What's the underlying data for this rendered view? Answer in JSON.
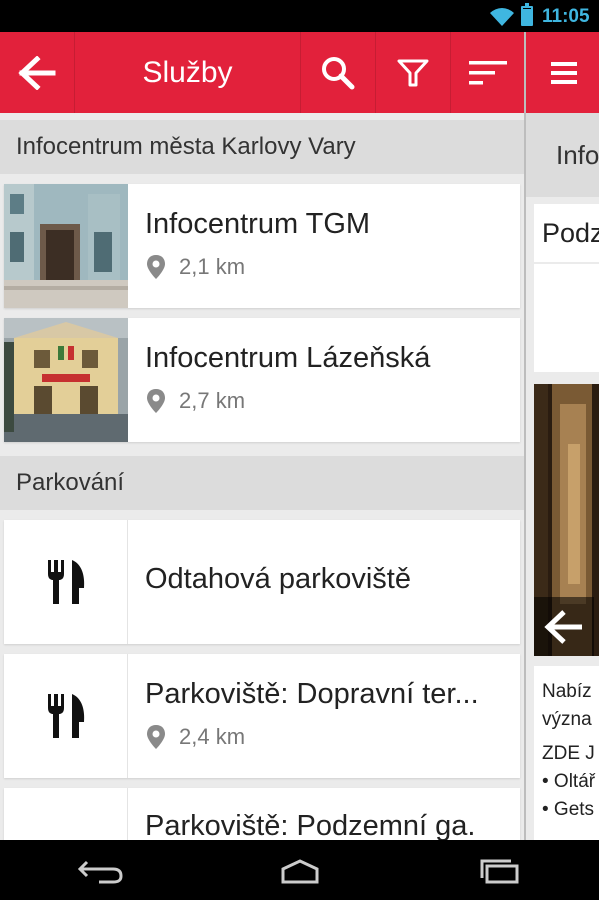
{
  "status_bar": {
    "time": "11:05"
  },
  "app_bar": {
    "title": "Služby"
  },
  "sections": [
    {
      "header": "Infocentrum města Karlovy Vary",
      "items": [
        {
          "name": "Infocentrum TGM",
          "distance": "2,1 km"
        },
        {
          "name": "Infocentrum Lázeňská",
          "distance": "2,7 km"
        }
      ]
    },
    {
      "header": "Parkování",
      "items": [
        {
          "name": "Odtahová parkoviště"
        },
        {
          "name": "Parkoviště: Dopravní ter...",
          "distance": "2,4 km"
        },
        {
          "name": "Parkoviště: Podzemní ga."
        }
      ]
    }
  ],
  "side_panel": {
    "header_fragment": "Info",
    "item_title_fragment": "Podz",
    "text_lines": [
      "Nabíz",
      "význa",
      "ZDE J",
      "• Oltář",
      "• Gets"
    ]
  },
  "icons": {
    "back": "arrow-left-icon",
    "search": "search-icon",
    "filter": "filter-icon",
    "sort": "sort-icon",
    "menu": "hamburger-menu-icon",
    "distance": "map-pin-icon",
    "category": "fork-knife-icon"
  },
  "colors": {
    "accent": "#e2213b",
    "status_accent": "#3fb6e0"
  }
}
